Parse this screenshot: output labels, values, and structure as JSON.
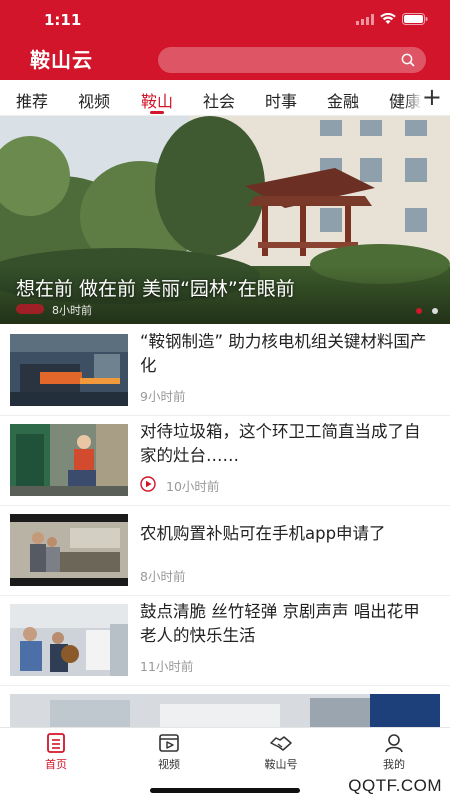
{
  "status_bar": {
    "time": "1:11"
  },
  "header": {
    "logo": "鞍山云",
    "search_placeholder": ""
  },
  "tabs": [
    {
      "label": "推荐"
    },
    {
      "label": "视频"
    },
    {
      "label": "鞍山",
      "active": true
    },
    {
      "label": "社会"
    },
    {
      "label": "时事"
    },
    {
      "label": "金融"
    },
    {
      "label": "健康"
    }
  ],
  "add_tab_symbol": "+",
  "hero": {
    "title": "想在前 做在前 美丽“园林”在眼前",
    "time": "8小时前",
    "slide_count": 2,
    "active_slide": 1
  },
  "news": [
    {
      "title": "“鞍钢制造” 助力核电机组关键材料国产化",
      "time": "9小时前",
      "video": false,
      "thumb": "steel"
    },
    {
      "title": "对待垃圾箱，这个环卫工简直当成了自家的灶台……",
      "time": "10小时前",
      "video": true,
      "thumb": "worker"
    },
    {
      "title": "农机购置补贴可在手机app申请了",
      "time": "8小时前",
      "video": false,
      "thumb": "office"
    },
    {
      "title": "鼓点清脆 丝竹轻弹 京剧声声 唱出花甲老人的快乐生活",
      "time": "11小时前",
      "video": false,
      "thumb": "music"
    }
  ],
  "bottom_nav": [
    {
      "label": "首页",
      "icon": "home-icon",
      "active": true
    },
    {
      "label": "视频",
      "icon": "video-icon",
      "active": false
    },
    {
      "label": "鞍山号",
      "icon": "handshake-icon",
      "active": false
    },
    {
      "label": "我的",
      "icon": "user-icon",
      "active": false
    }
  ],
  "watermark": "QQTF.COM",
  "colors": {
    "brand": "#d2152a",
    "text": "#222222",
    "muted": "#999999"
  }
}
